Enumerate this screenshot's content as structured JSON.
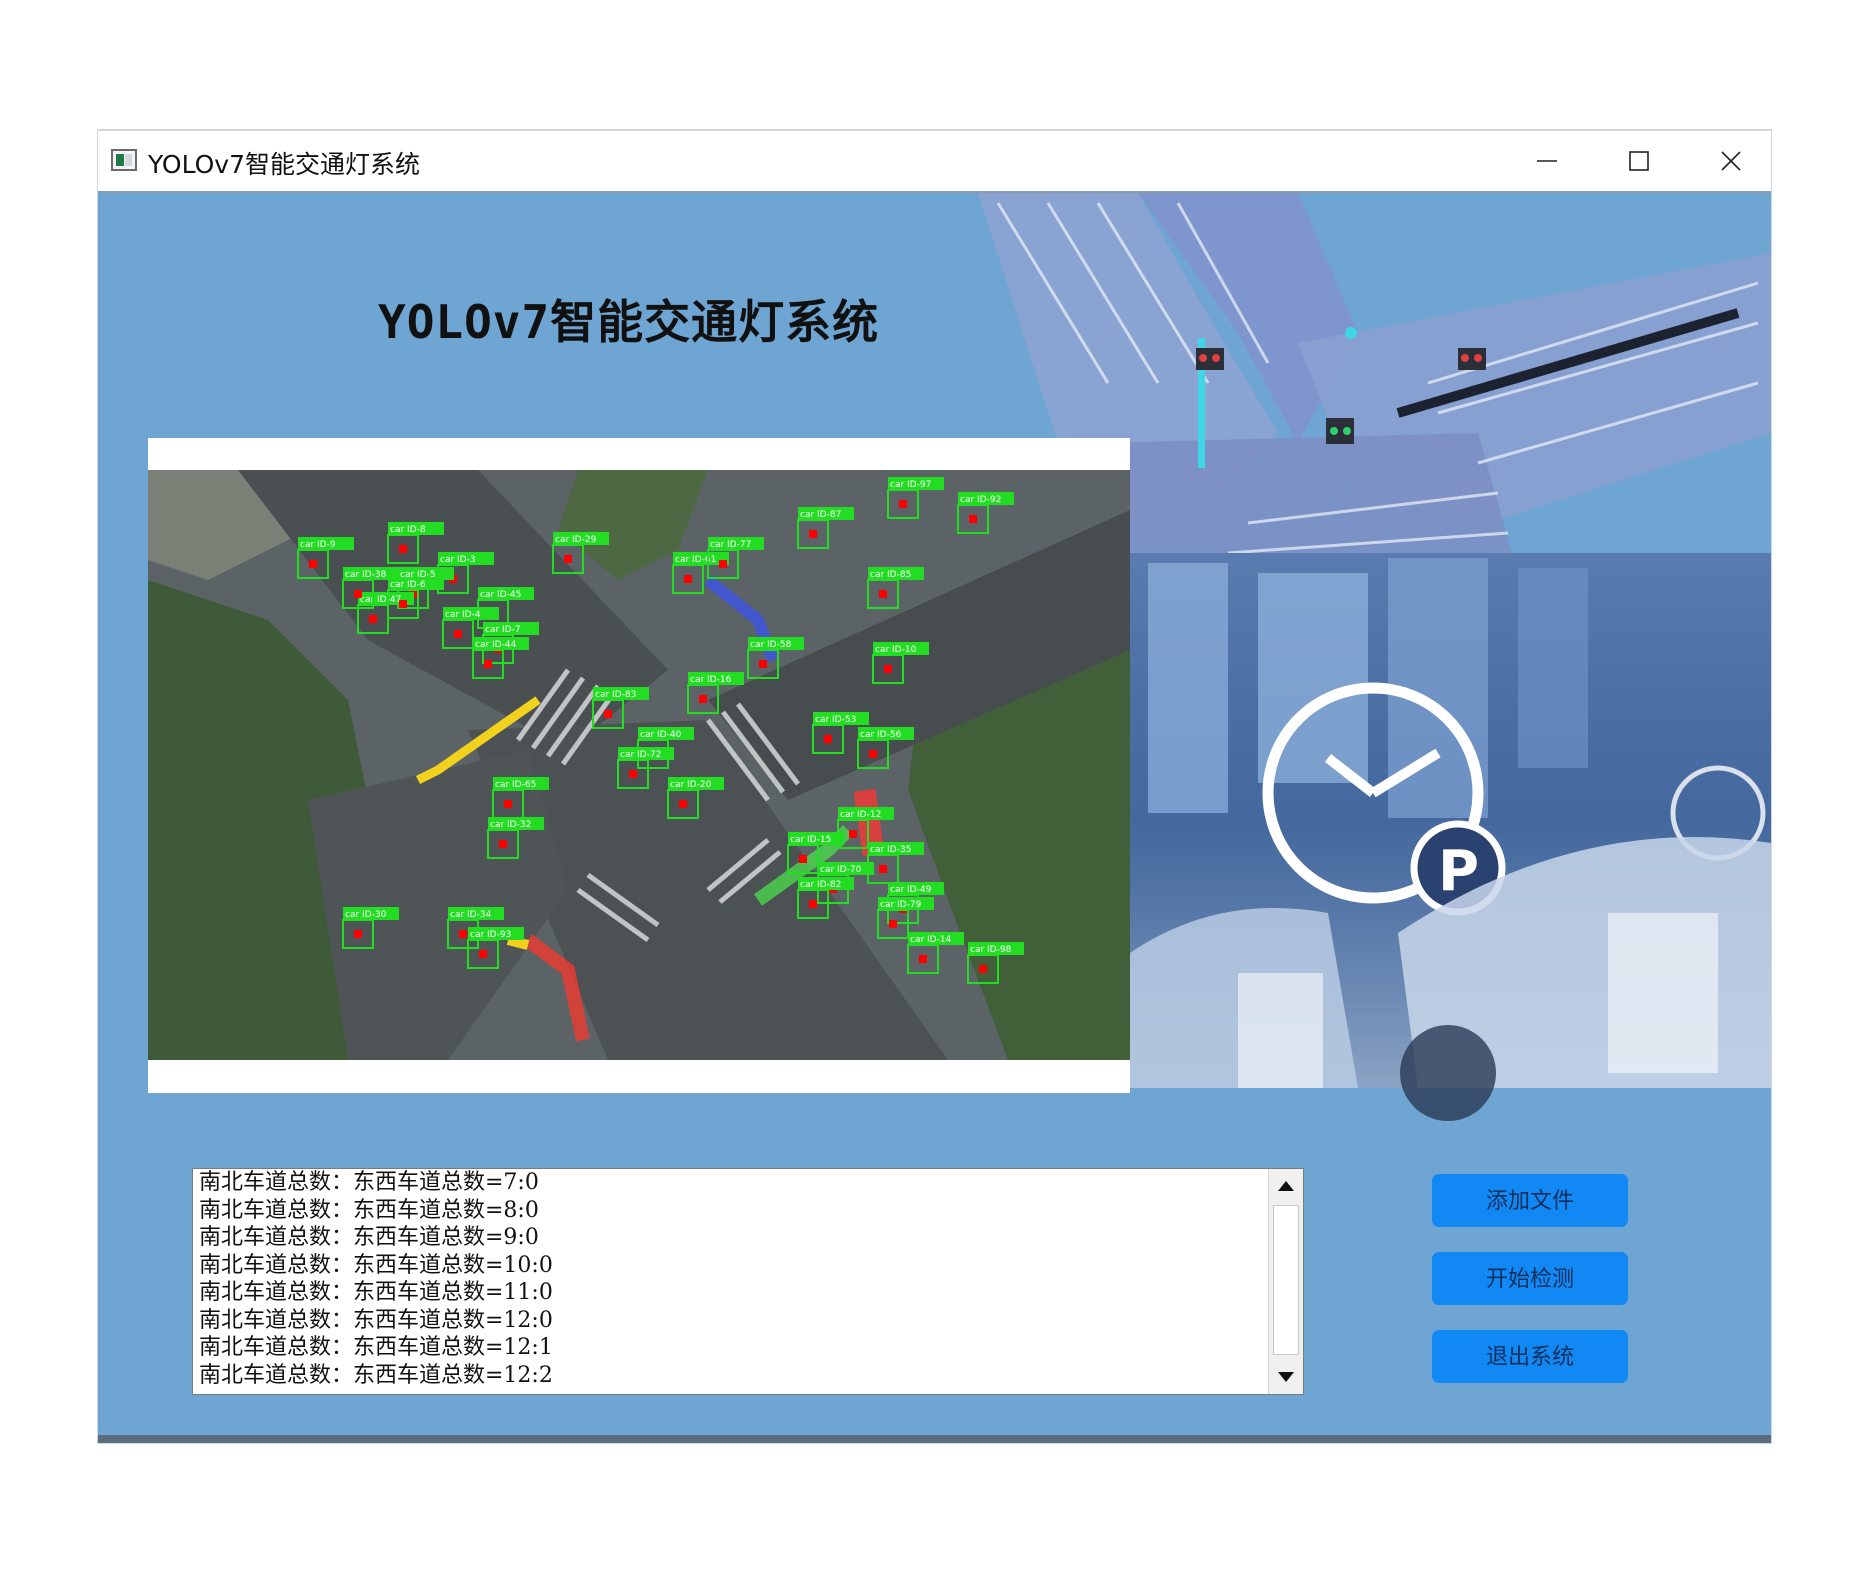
{
  "window": {
    "title": "YOLOv7智能交通灯系统"
  },
  "main": {
    "heading": "YOLOv7智能交通灯系统"
  },
  "video": {
    "detections": [
      {
        "label": "car ID-9"
      },
      {
        "label": "car ID-8"
      },
      {
        "label": "car ID-3"
      },
      {
        "label": "car ID-5"
      },
      {
        "label": "car ID-45"
      },
      {
        "label": "car ID-47"
      },
      {
        "label": "car ID-4"
      },
      {
        "label": "car ID-7"
      },
      {
        "label": "car ID-44"
      },
      {
        "label": "car ID-38"
      },
      {
        "label": "car ID-6"
      },
      {
        "label": "car ID-29"
      },
      {
        "label": "car ID-61"
      },
      {
        "label": "car ID-77"
      },
      {
        "label": "car ID-87"
      },
      {
        "label": "car ID-97"
      },
      {
        "label": "car ID-92"
      },
      {
        "label": "car ID-85"
      },
      {
        "label": "car ID-58"
      },
      {
        "label": "car ID-10"
      },
      {
        "label": "car ID-16"
      },
      {
        "label": "car ID-83"
      },
      {
        "label": "car ID-40"
      },
      {
        "label": "car ID-72"
      },
      {
        "label": "car ID-53"
      },
      {
        "label": "car ID-56"
      },
      {
        "label": "car ID-65"
      },
      {
        "label": "car ID-20"
      },
      {
        "label": "car ID-32"
      },
      {
        "label": "car ID-12"
      },
      {
        "label": "car ID-15"
      },
      {
        "label": "car ID-35"
      },
      {
        "label": "car ID-70"
      },
      {
        "label": "car ID-82"
      },
      {
        "label": "car ID-49"
      },
      {
        "label": "car ID-79"
      },
      {
        "label": "car ID-30"
      },
      {
        "label": "car ID-34"
      },
      {
        "label": "car ID-93"
      },
      {
        "label": "car ID-14"
      },
      {
        "label": "car ID-98"
      }
    ]
  },
  "log": {
    "lines": [
      "南北车道总数：东西车道总数=7:0",
      "南北车道总数：东西车道总数=8:0",
      "南北车道总数：东西车道总数=9:0",
      "南北车道总数：东西车道总数=10:0",
      "南北车道总数：东西车道总数=11:0",
      "南北车道总数：东西车道总数=12:0",
      "南北车道总数：东西车道总数=12:1",
      "南北车道总数：东西车道总数=12:2"
    ]
  },
  "buttons": {
    "add_file": "添加文件",
    "start_detect": "开始检测",
    "exit_system": "退出系统"
  },
  "colors": {
    "background": "#6fa5d2",
    "button": "#1188f3",
    "detection_box": "#22dd22",
    "detection_center": "#ff0000"
  }
}
